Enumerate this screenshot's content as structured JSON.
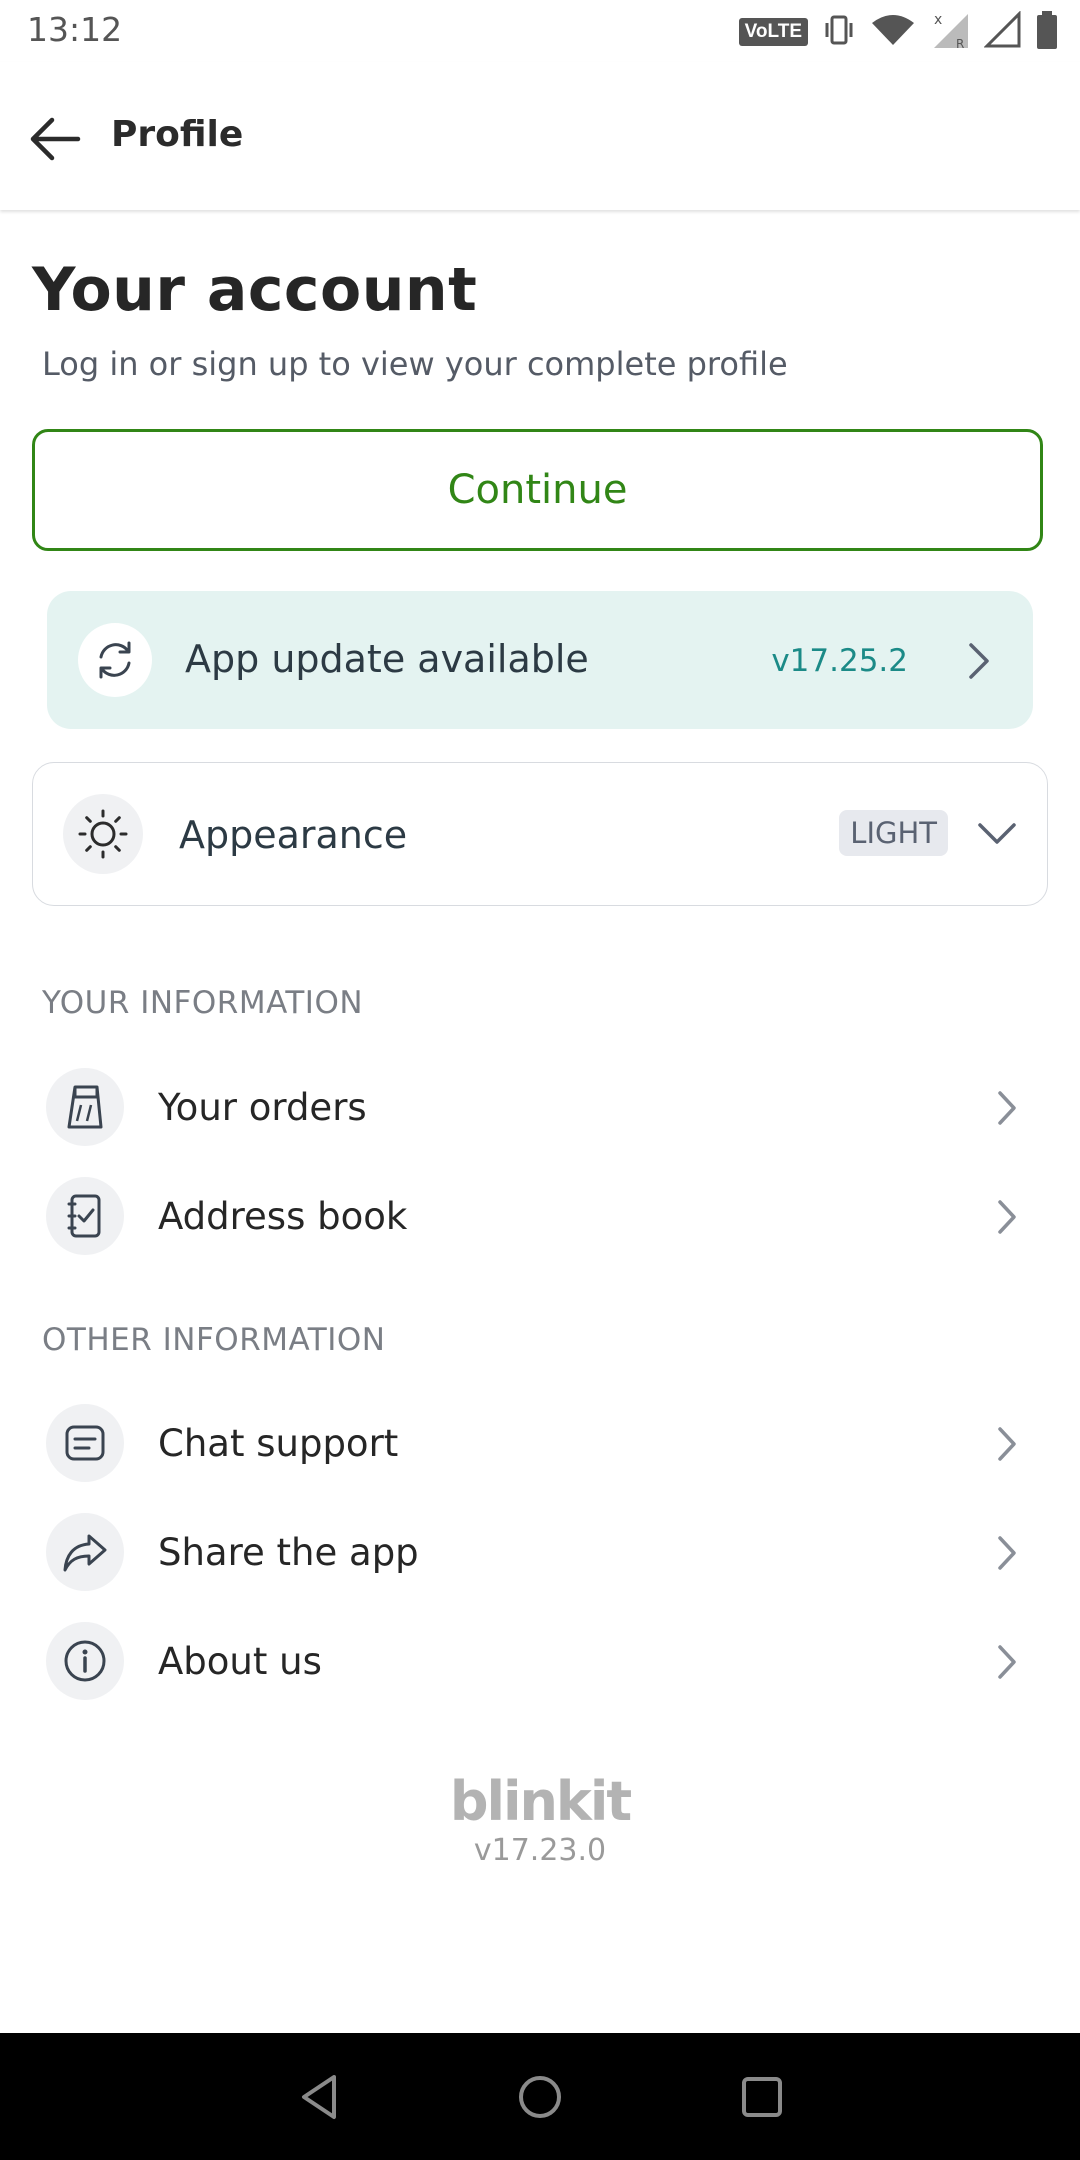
{
  "status_bar": {
    "time": "13:12",
    "volte_label": "VoLTE",
    "icons": [
      "volte-icon",
      "vibrate-icon",
      "wifi-icon",
      "signal-roaming-icon",
      "signal-icon",
      "battery-icon"
    ]
  },
  "app_bar": {
    "title": "Profile",
    "back_icon": "arrow-left-icon"
  },
  "account": {
    "title": "Your account",
    "subtitle": "Log in or sign up to view your complete profile",
    "continue_label": "Continue"
  },
  "update_banner": {
    "label": "App update available",
    "version": "v17.25.2",
    "icon": "refresh-icon"
  },
  "appearance": {
    "label": "Appearance",
    "value": "LIGHT",
    "icon": "sun-icon"
  },
  "sections": [
    {
      "header": "YOUR INFORMATION",
      "items": [
        {
          "label": "Your orders",
          "icon": "shopping-bag-icon"
        },
        {
          "label": "Address book",
          "icon": "address-book-icon"
        }
      ]
    },
    {
      "header": "OTHER INFORMATION",
      "items": [
        {
          "label": "Chat support",
          "icon": "chat-icon"
        },
        {
          "label": "Share the app",
          "icon": "share-icon"
        },
        {
          "label": "About us",
          "icon": "info-icon"
        }
      ]
    }
  ],
  "footer": {
    "brand": "blinkit",
    "version": "v17.23.0"
  },
  "colors": {
    "primary_green": "#318616",
    "update_bg": "#e4f3f1",
    "update_accent": "#1b8a87"
  }
}
